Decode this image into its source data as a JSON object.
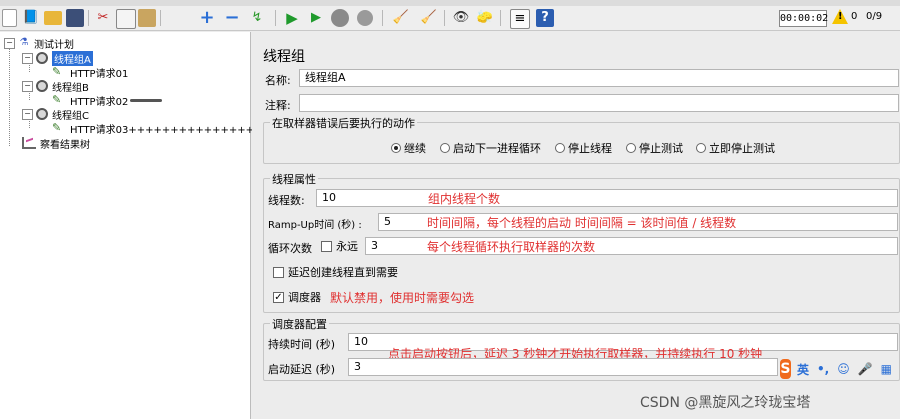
{
  "toolbar": {
    "icons": [
      "new-icon",
      "templates-icon",
      "open-icon",
      "save-icon",
      "cut-icon",
      "copy-icon",
      "paste-icon",
      "expand-icon",
      "collapse-icon",
      "toggle-icon",
      "start-icon",
      "start-no-pause-icon",
      "stop-icon",
      "shutdown-icon",
      "clear-icon",
      "clear-all-icon",
      "search-icon",
      "reset-search-icon",
      "function-helper-icon",
      "help-icon"
    ],
    "timer": "00:00:02",
    "warning_count": "0",
    "threads": "0/9"
  },
  "tree": {
    "root": "测试计划",
    "groups": [
      {
        "label": "线程组A",
        "child": "HTTP请求01",
        "selected": true
      },
      {
        "label": "线程组B",
        "child": "HTTP请求02"
      },
      {
        "label": "线程组C",
        "child": "HTTP请求03+++++++++++++++++"
      }
    ],
    "listener": "察看结果树"
  },
  "panel": {
    "title": "线程组",
    "name_label": "名称:",
    "name_value": "线程组A",
    "comment_label": "注释:",
    "comment_value": "",
    "error_action": {
      "title": "在取样器错误后要执行的动作",
      "options": [
        "继续",
        "启动下一进程循环",
        "停止线程",
        "停止测试",
        "立即停止测试"
      ],
      "selected": "继续"
    },
    "thread_props": {
      "title": "线程属性",
      "threads_label": "线程数:",
      "threads_value": "10",
      "threads_note": "组内线程个数",
      "rampup_label": "Ramp-Up时间 (秒) :",
      "rampup_value": "5",
      "rampup_note": "时间间隔，每个线程的启动 时间间隔 = 该时间值 / 线程数",
      "loop_label": "循环次数",
      "forever_label": "永远",
      "loop_value": "3",
      "loop_note": "每个线程循环执行取样器的次数",
      "delay_label": "延迟创建线程直到需要",
      "scheduler_label": "调度器",
      "scheduler_note": "默认禁用，使用时需要勾选"
    },
    "scheduler_config": {
      "title": "调度器配置",
      "duration_label": "持续时间 (秒)",
      "duration_value": "10",
      "delay_label": "启动延迟 (秒)",
      "delay_value": "3",
      "note": "点击启动按钮后，延迟 3 秒钟才开始执行取样器，并持续执行 10 秒钟"
    }
  },
  "ime": {
    "logo": "S",
    "mode": "英",
    "items": [
      "•,",
      "☺",
      "🎤",
      "▦"
    ]
  },
  "watermark": "CSDN @黑旋风之玲珑宝塔"
}
